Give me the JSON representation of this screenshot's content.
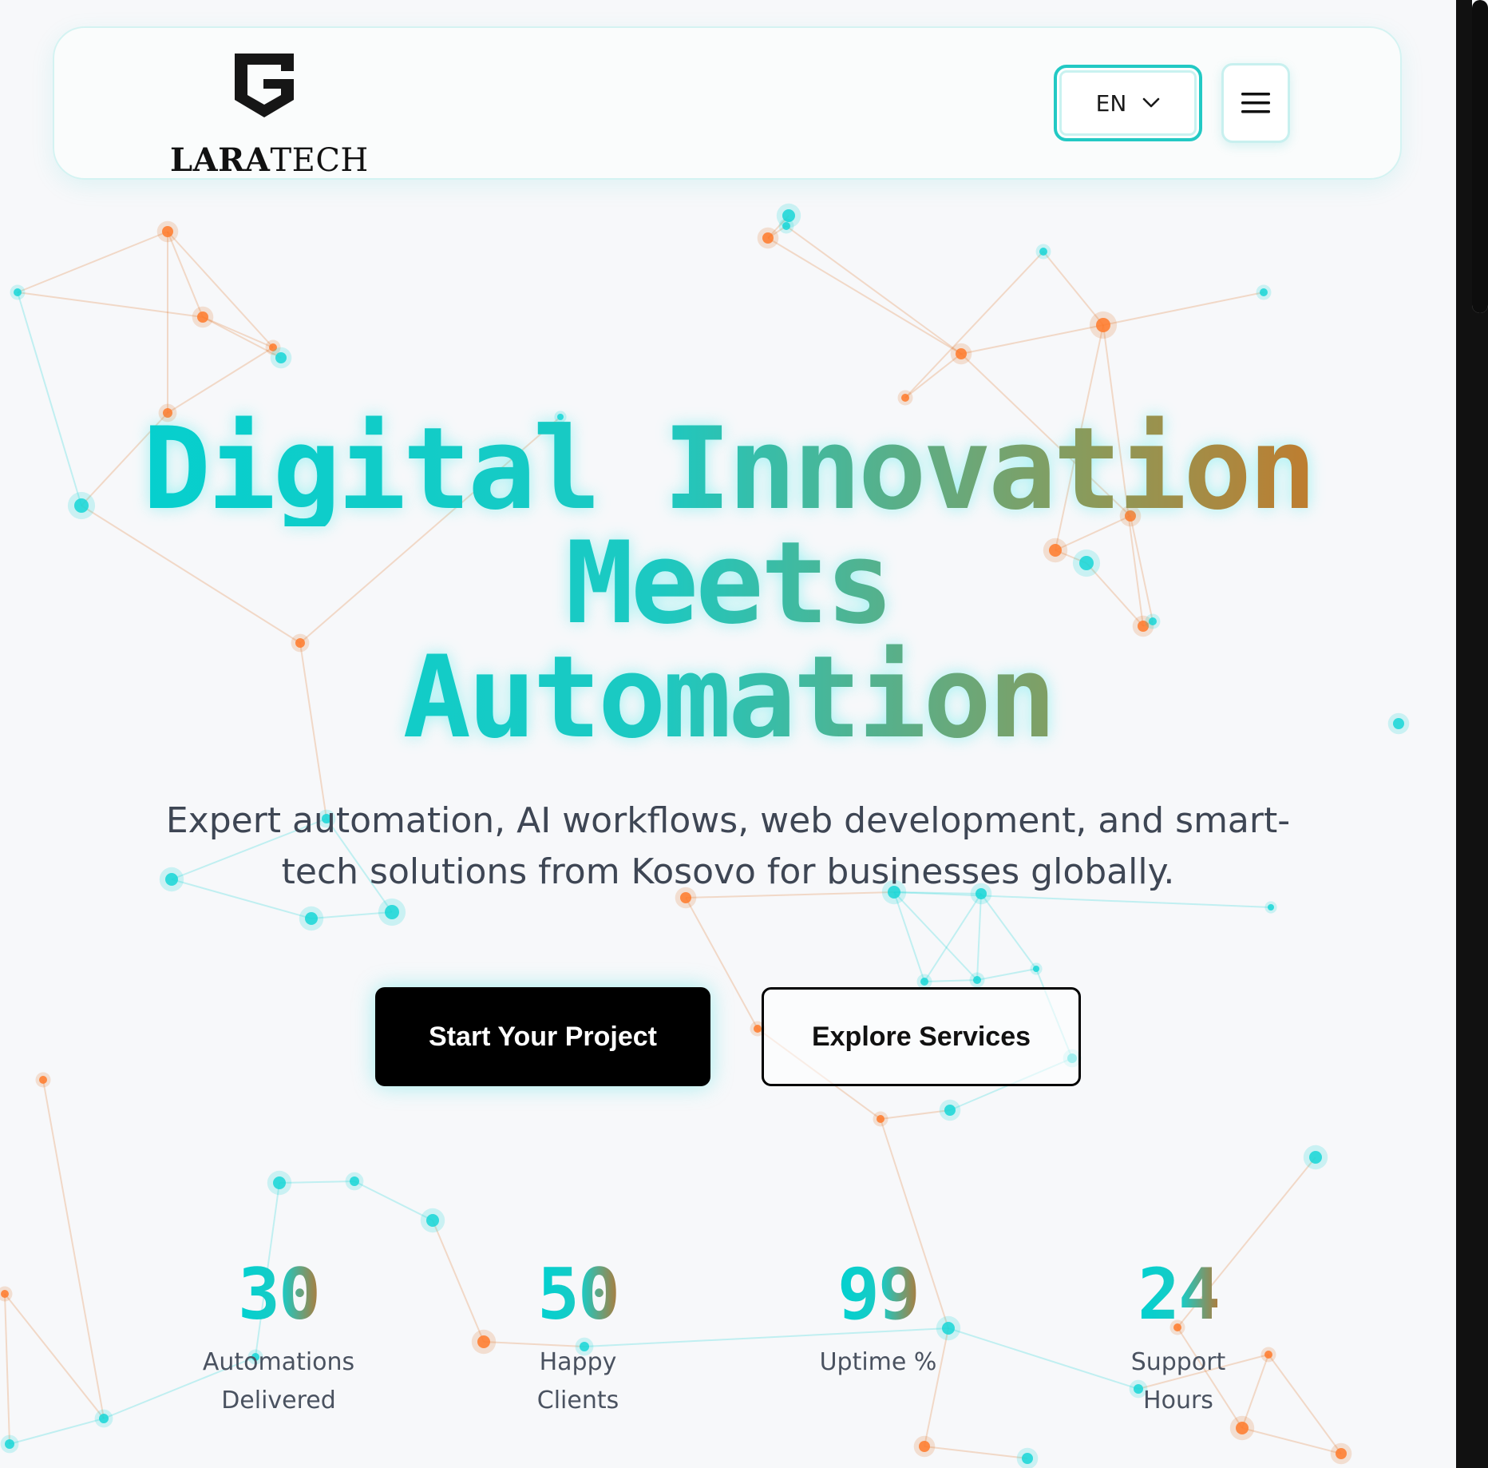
{
  "header": {
    "logo_text_bold": "LARA",
    "logo_text_thin": "TECH",
    "language": "EN",
    "menu_icon": "hamburger-icon"
  },
  "hero": {
    "title_line1": "Digital Innovation",
    "title_line2": "Meets",
    "title_line3": "Automation",
    "subtitle": "Expert automation, AI workflows, web development, and smart-tech solutions from Kosovo for businesses globally.",
    "primary_cta": "Start Your Project",
    "secondary_cta": "Explore Services"
  },
  "stats": [
    {
      "number": "30",
      "label": "Automations Delivered"
    },
    {
      "number": "50",
      "label": "Happy Clients"
    },
    {
      "number": "99",
      "label": "Uptime %"
    },
    {
      "number": "24",
      "label": "Support Hours"
    }
  ],
  "colors": {
    "accent_cyan": "#00d1d1",
    "accent_orange": "#e06a14",
    "text_dark": "#111111",
    "text_muted": "#3e4654",
    "background": "#f7f8fa"
  }
}
